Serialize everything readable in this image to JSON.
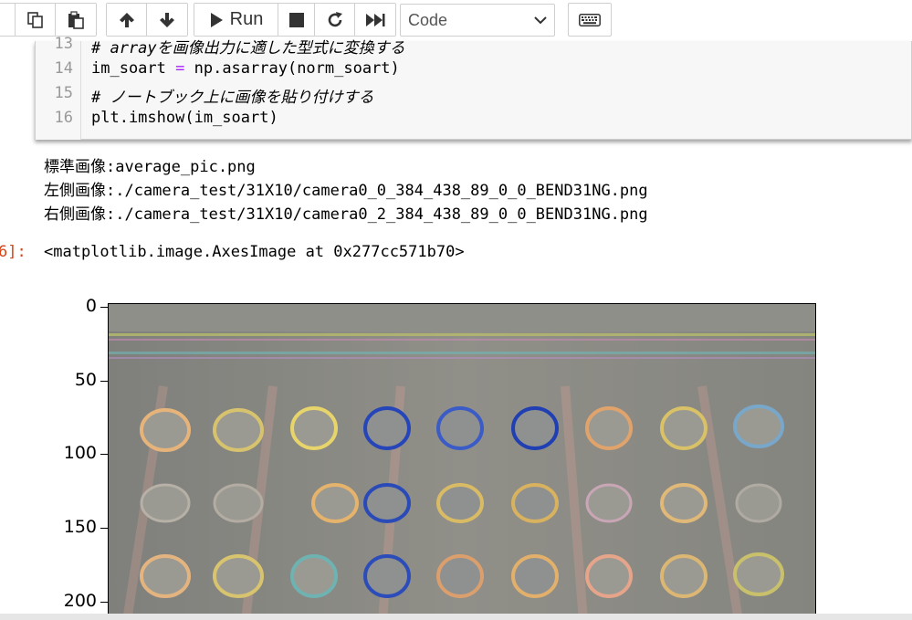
{
  "toolbar": {
    "run_label": "Run",
    "cell_type": "Code",
    "icons": [
      "cut-icon",
      "copy-icon",
      "paste-icon",
      "move-up-icon",
      "move-down-icon",
      "run-icon",
      "stop-icon",
      "restart-icon",
      "fast-forward-icon",
      "keyboard-icon"
    ]
  },
  "code": {
    "lines": [
      {
        "num": "13",
        "text": "# arrayを画像出力に適した型式に変換する"
      },
      {
        "num": "14",
        "part1": "im_soart ",
        "op": "=",
        "part2": " np.asarray(norm_soart)"
      },
      {
        "num": "15",
        "text": "# ノートブック上に画像を貼り付けする"
      },
      {
        "num": "16",
        "text": "plt.imshow(im_soart)"
      }
    ]
  },
  "output": {
    "stdout": [
      "標準画像:average_pic.png",
      "左側画像:./camera_test/31X10/camera0_0_384_438_89_0_0_BEND31NG.png",
      "右側画像:./camera_test/31X10/camera0_2_384_438_89_0_0_BEND31NG.png"
    ],
    "prompt": "6]:",
    "result": "<matplotlib.image.AxesImage at 0x277cc571b70>"
  },
  "plot": {
    "y_ticks": [
      "0",
      "50",
      "100",
      "150",
      "200"
    ]
  },
  "colors": {
    "comment": "#007a7a",
    "operator": "#aa22ff",
    "prompt_out": "#d84315",
    "image_bg": "#8c8c86"
  }
}
